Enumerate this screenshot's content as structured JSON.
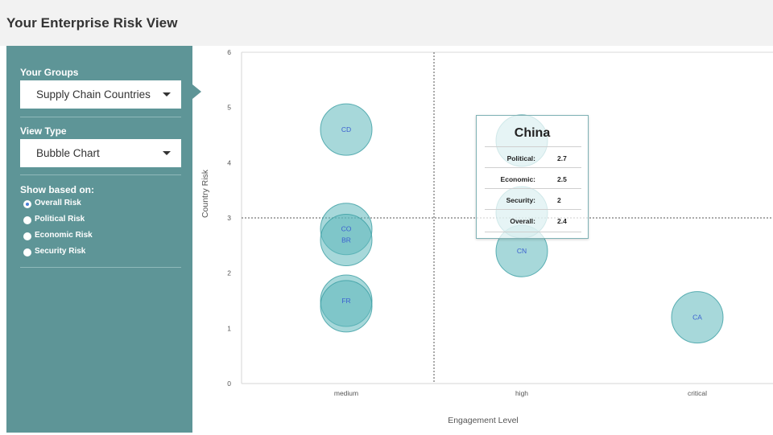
{
  "page_title": "Your Enterprise Risk View",
  "sidebar": {
    "groups_label": "Your Groups",
    "groups_value": "Supply Chain Countries",
    "view_type_label": "View Type",
    "view_type_value": "Bubble Chart",
    "show_label": "Show based on:",
    "options": [
      {
        "label": "Overall Risk",
        "selected": true
      },
      {
        "label": "Political Risk",
        "selected": false
      },
      {
        "label": "Economic Risk",
        "selected": false
      },
      {
        "label": "Security Risk",
        "selected": false
      }
    ]
  },
  "colors": {
    "sidebar": "#5e9597",
    "bubble_fill": "#5fb8bc",
    "bubble_stroke": "#3a9ea3",
    "bubble_label": "#3a5fd0"
  },
  "chart_data": {
    "type": "scatter",
    "xlabel": "Engagement Level",
    "ylabel": "Country Risk",
    "x_categories": [
      "medium",
      "high",
      "critical"
    ],
    "ylim": [
      0,
      6
    ],
    "y_ticks": [
      "0",
      "1",
      "2",
      "3",
      "4",
      "5",
      "6"
    ],
    "grid": false,
    "reference_lines": {
      "x_category": "medium/high boundary",
      "y": 3
    },
    "points": [
      {
        "label": "CD",
        "x": "medium",
        "y": 4.6
      },
      {
        "label": "CO",
        "x": "medium",
        "y": 2.8
      },
      {
        "label": "BR",
        "x": "medium",
        "y": 2.6
      },
      {
        "label": "FR",
        "x": "medium",
        "y": 1.5
      },
      {
        "label": "",
        "x": "medium",
        "y": 1.4
      },
      {
        "label": "CN",
        "x": "high",
        "y": 2.4
      },
      {
        "label": "",
        "x": "high",
        "y": 3.1
      },
      {
        "label": "",
        "x": "high",
        "y": 4.4
      },
      {
        "label": "CA",
        "x": "critical",
        "y": 1.2
      }
    ]
  },
  "tooltip": {
    "title": "China",
    "rows": [
      {
        "key": "Political:",
        "value": "2.7"
      },
      {
        "key": "Economic:",
        "value": "2.5"
      },
      {
        "key": "Security:",
        "value": "2"
      },
      {
        "key": "Overall:",
        "value": "2.4"
      }
    ]
  }
}
